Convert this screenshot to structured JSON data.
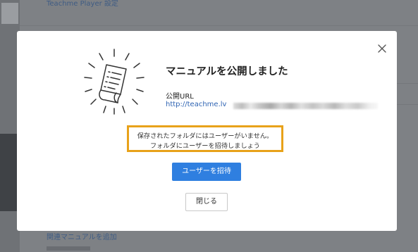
{
  "background": {
    "header_title": "Teachme Player 設定",
    "link_add_manual": "関連マニュアルを追加"
  },
  "modal": {
    "title": "マニュアルを公開しました",
    "url_label": "公開URL",
    "url_text": "http://teachme.lv",
    "notice_line1": "保存されたフォルダにはユーザーがいません。",
    "notice_line2": "フォルダにユーザーを招待しましょう",
    "invite_button": "ユーザーを招待",
    "close_button": "閉じる",
    "close_icon": "close-icon",
    "illustration_icon": "published-document-icon"
  },
  "colors": {
    "accent": "#2f7fe0",
    "highlight_border": "#e8a21a",
    "link": "#2f64b3"
  }
}
